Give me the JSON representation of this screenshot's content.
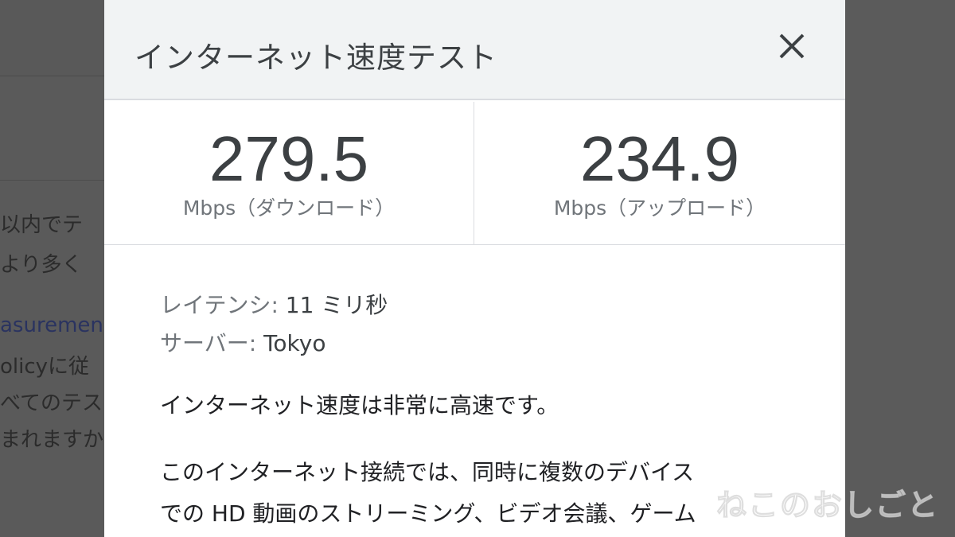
{
  "background": {
    "lines": [
      "以内でテ",
      "より多く",
      "asuremen",
      "olicyに従",
      "べてのテス",
      "まれますか"
    ]
  },
  "dialog": {
    "title": "インターネット速度テスト",
    "close_icon": "close-icon",
    "download": {
      "value": "279.5",
      "unit": "Mbps（ダウンロード）"
    },
    "upload": {
      "value": "234.9",
      "unit": "Mbps（アップロード）"
    },
    "latency": {
      "label": "レイテンシ:",
      "value": "11 ミリ秒"
    },
    "server": {
      "label": "サーバー:",
      "value": "Tokyo"
    },
    "summary": "インターネット速度は非常に高速です。",
    "description": [
      "このインターネット接続では、同時に複数のデバイス",
      "での HD 動画のストリーミング、ビデオ会議、ゲーム"
    ]
  },
  "watermark": "ねこのおしごと",
  "colors": {
    "header_bg": "#f1f3f4",
    "text_primary": "#3c4043",
    "text_secondary": "#70757a",
    "overlay": "#5a5a5a"
  }
}
